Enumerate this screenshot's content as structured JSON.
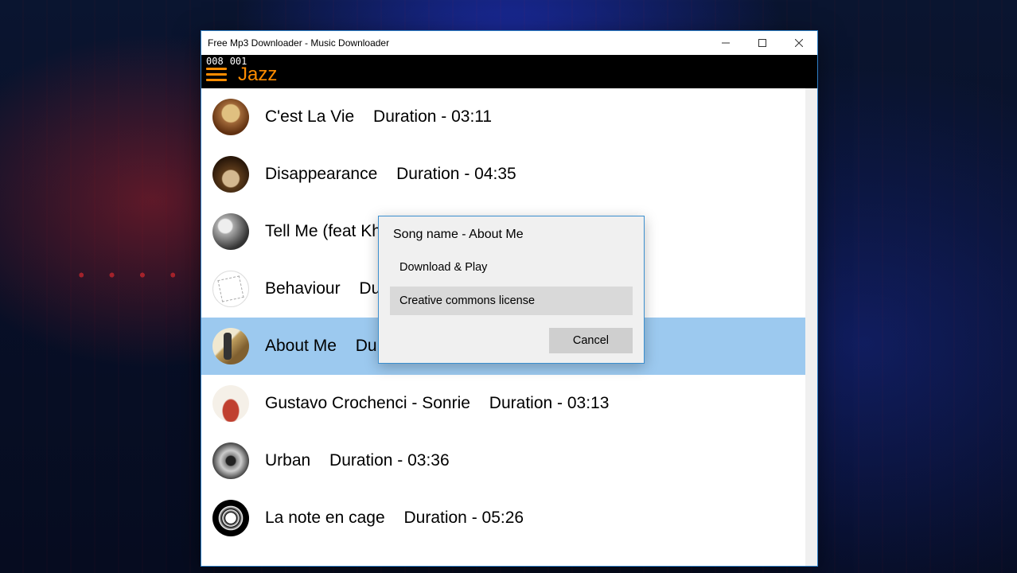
{
  "window": {
    "title": "Free Mp3 Downloader - Music Downloader"
  },
  "blackbar": {
    "counter_a": "008",
    "counter_b": "001",
    "category": "Jazz"
  },
  "songs": [
    {
      "name": "C'est La Vie",
      "duration_label": "Duration - 03:11",
      "selected": false
    },
    {
      "name": "Disappearance",
      "duration_label": "Duration - 04:35",
      "selected": false
    },
    {
      "name": "Tell Me (feat Khaos)",
      "duration_label": "",
      "selected": false
    },
    {
      "name": "Behaviour",
      "duration_label": "Duration -",
      "selected": false
    },
    {
      "name": "About Me",
      "duration_label": "Duration -",
      "selected": true
    },
    {
      "name": "Gustavo Crochenci - Sonrie",
      "duration_label": "Duration - 03:13",
      "selected": false
    },
    {
      "name": "Urban",
      "duration_label": "Duration - 03:36",
      "selected": false
    },
    {
      "name": "La note en cage",
      "duration_label": "Duration - 05:26",
      "selected": false
    }
  ],
  "modal": {
    "title": "Song name - About Me",
    "option_download": "Download & Play",
    "option_license": "Creative commons license",
    "cancel": "Cancel"
  }
}
